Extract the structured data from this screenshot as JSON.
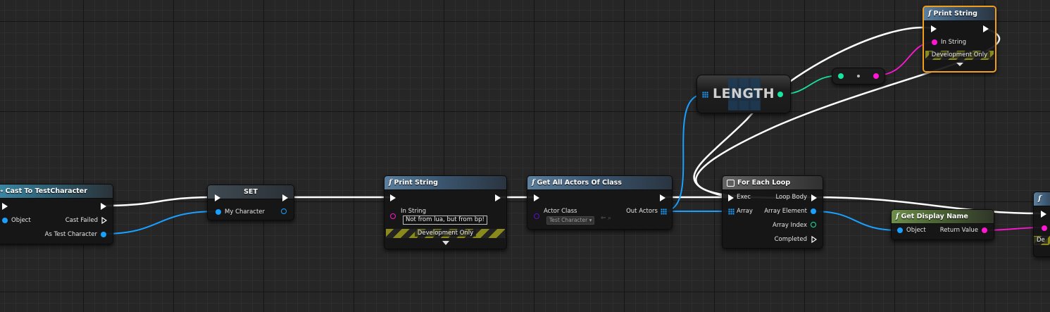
{
  "colors": {
    "exec_wire": "#ffffff",
    "object_pin": "#1aa0ff",
    "string_pin": "#ff17d1",
    "integer_pin": "#19e3a0",
    "class_pin": "#5a10c8",
    "bool_out_pin": "#19e3a0",
    "selection_outline": "#f19e1e"
  },
  "nodes": {
    "cast": {
      "title": "Cast To TestCharacter",
      "icon": "cast-arrows-icon",
      "pins": {
        "object": "Object",
        "cast_failed": "Cast Failed",
        "as_test_character": "As Test Character"
      }
    },
    "set": {
      "title": "SET",
      "pins": {
        "my_character": "My Character"
      }
    },
    "print1": {
      "title": "Print String",
      "icon": "function-icon",
      "pins": {
        "in_string": "In String"
      },
      "in_string_value": "Not from lua, but from bp!",
      "dev_label": "Development Only"
    },
    "get_all": {
      "title": "Get All Actors Of Class",
      "icon": "function-icon",
      "pins": {
        "actor_class": "Actor Class",
        "out_actors": "Out Actors"
      },
      "class_value": "Test Character"
    },
    "length": {
      "label": "LENGTH"
    },
    "foreach": {
      "title": "For Each Loop",
      "icon": "macro-icon",
      "pins": {
        "exec": "Exec",
        "array": "Array",
        "loop_body": "Loop Body",
        "array_element": "Array Element",
        "array_index": "Array Index",
        "completed": "Completed"
      }
    },
    "get_display": {
      "title": "Get Display Name",
      "icon": "function-icon",
      "pins": {
        "object": "Object",
        "return_value": "Return Value"
      }
    },
    "print2": {
      "title": "Print String",
      "icon": "function-icon",
      "pins": {
        "in_string": "In String"
      },
      "dev_label": "Development Only"
    },
    "print3": {
      "dev_label": "De"
    }
  }
}
